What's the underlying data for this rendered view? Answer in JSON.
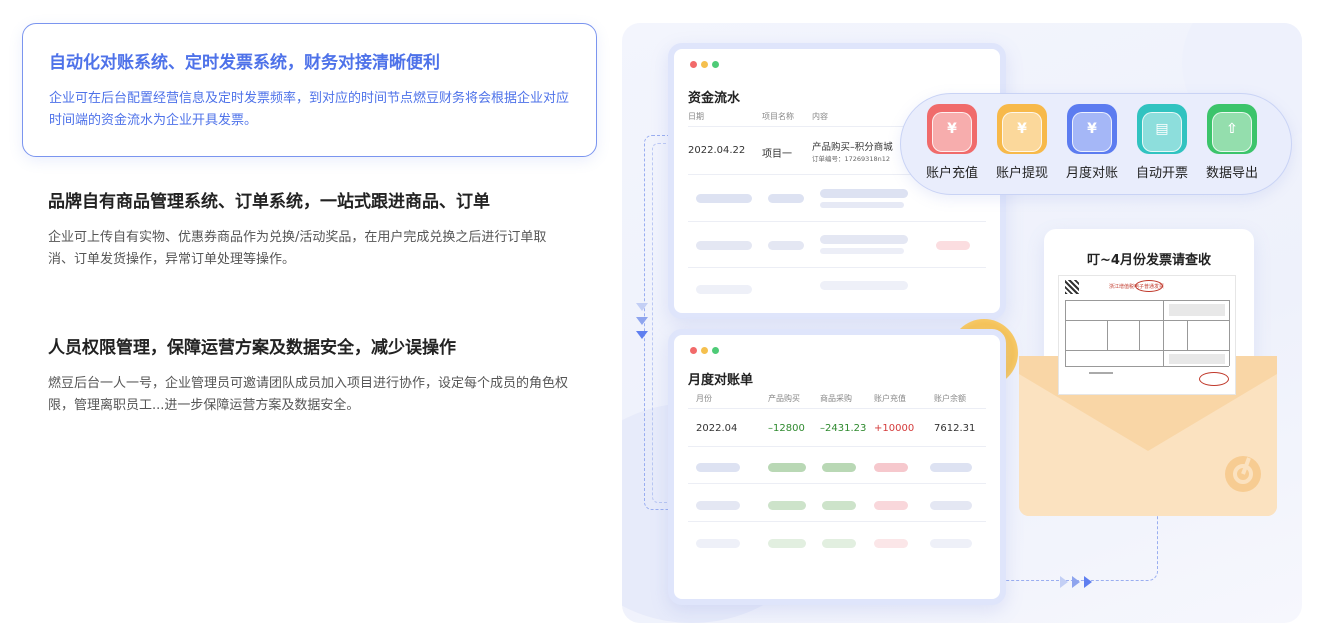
{
  "features": [
    {
      "title": "自动化对账系统、定时发票系统，财务对接清晰便利",
      "desc": "企业可在后台配置经营信息及定时发票频率，到对应的时间节点燃豆财务将会根据企业对应时间端的资金流水为企业开具发票。"
    },
    {
      "title": "品牌自有商品管理系统、订单系统，一站式跟进商品、订单",
      "desc": "企业可上传自有实物、优惠券商品作为兑换/活动奖品，在用户完成兑换之后进行订单取消、订单发货操作，异常订单处理等操作。"
    },
    {
      "title": "人员权限管理，保障运营方案及数据安全，减少误操作",
      "desc": "燃豆后台一人一号，企业管理员可邀请团队成员加入项目进行协作，设定每个成员的角色权限，管理离职员工...进一步保障运营方案及数据安全。"
    }
  ],
  "cashflow": {
    "title": "资金流水",
    "headers": [
      "日期",
      "项目名称",
      "内容"
    ],
    "row": {
      "date": "2022.04.22",
      "item": "项目一",
      "content": "产品购买–积分商城",
      "order": "订单编号：17269318n12"
    }
  },
  "monthly": {
    "title": "月度对账单",
    "headers": [
      "月份",
      "产品购买",
      "商品采购",
      "账户充值",
      "账户余额"
    ],
    "row": {
      "month": "2022.04",
      "purchase": "–12800",
      "procure": "–2431.23",
      "recharge": "+10000",
      "balance": "7612.31"
    }
  },
  "actions": [
    {
      "label": "账户充值",
      "icon": "piggy-bank-yen-icon",
      "color": "#f06b6b"
    },
    {
      "label": "账户提现",
      "icon": "piggy-bank-withdraw-icon",
      "color": "#f7b94a"
    },
    {
      "label": "月度对账",
      "icon": "statement-yen-icon",
      "color": "#5c7cf0"
    },
    {
      "label": "自动开票",
      "icon": "printer-icon",
      "color": "#31c3c0"
    },
    {
      "label": "数据导出",
      "icon": "upload-icon",
      "color": "#3cc46b"
    }
  ],
  "invoice": {
    "title": "叮~4月份发票请查收",
    "heading": "浙江增值税电子普通发票"
  },
  "colors": {
    "accent": "#4e72e9",
    "positive": "#2f8a2f",
    "negative": "#d43a3a"
  }
}
